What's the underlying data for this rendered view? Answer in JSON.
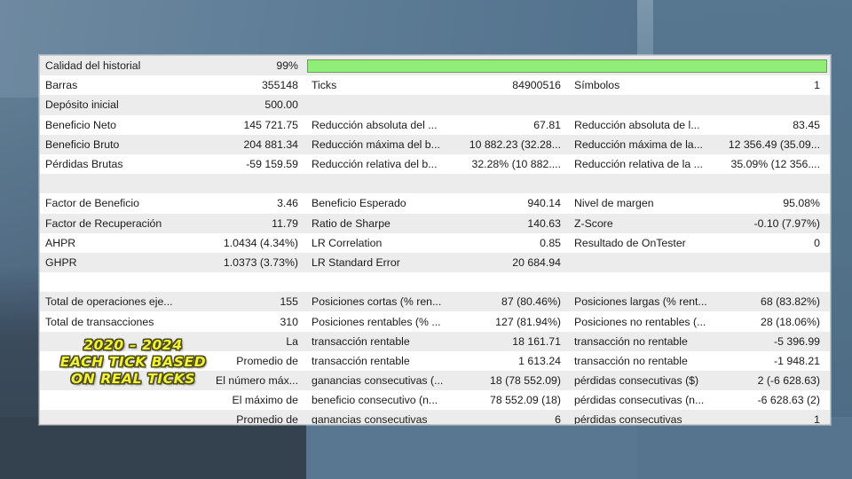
{
  "report": {
    "progress_bar": {
      "label": "",
      "color": "#90ee78",
      "percent": 100
    },
    "rows": [
      {
        "type": "progress",
        "c1_label": "Calidad del historial",
        "c1_value": "99%"
      },
      {
        "type": "data",
        "c1_label": "Barras",
        "c1_value": "355148",
        "c2_label": "Ticks",
        "c2_value": "84900516",
        "c3_label": "Símbolos",
        "c3_value": "1"
      },
      {
        "type": "data",
        "c1_label": "Depósito inicial",
        "c1_value": "500.00",
        "c2_label": "",
        "c2_value": "",
        "c3_label": "",
        "c3_value": ""
      },
      {
        "type": "data",
        "c1_label": "Beneficio Neto",
        "c1_value": "145 721.75",
        "c2_label": "Reducción absoluta del ...",
        "c2_value": "67.81",
        "c3_label": "Reducción absoluta de l...",
        "c3_value": "83.45"
      },
      {
        "type": "data",
        "c1_label": "Beneficio Bruto",
        "c1_value": "204 881.34",
        "c2_label": "Reducción máxima del b...",
        "c2_value": "10 882.23 (32.28...",
        "c3_label": "Reducción máxima de la...",
        "c3_value": "12 356.49 (35.09..."
      },
      {
        "type": "data",
        "c1_label": "Pérdidas Brutas",
        "c1_value": "-59 159.59",
        "c2_label": "Reducción relativa del b...",
        "c2_value": "32.28% (10 882....",
        "c3_label": "Reducción relativa de la ...",
        "c3_value": "35.09% (12 356...."
      },
      {
        "type": "blank",
        "c1_label": "",
        "c1_value": "",
        "c2_label": "",
        "c2_value": "",
        "c3_label": "",
        "c3_value": ""
      },
      {
        "type": "data",
        "c1_label": "Factor de Beneficio",
        "c1_value": "3.46",
        "c2_label": "Beneficio Esperado",
        "c2_value": "940.14",
        "c3_label": "Nivel de margen",
        "c3_value": "95.08%"
      },
      {
        "type": "data",
        "c1_label": "Factor de Recuperación",
        "c1_value": "11.79",
        "c2_label": "Ratio de Sharpe",
        "c2_value": "140.63",
        "c3_label": "Z-Score",
        "c3_value": "-0.10 (7.97%)"
      },
      {
        "type": "data",
        "c1_label": "AHPR",
        "c1_value": "1.0434 (4.34%)",
        "c2_label": "LR Correlation",
        "c2_value": "0.85",
        "c3_label": "Resultado de OnTester",
        "c3_value": "0"
      },
      {
        "type": "data",
        "c1_label": "GHPR",
        "c1_value": "1.0373 (3.73%)",
        "c2_label": "LR Standard Error",
        "c2_value": "20 684.94",
        "c3_label": "",
        "c3_value": ""
      },
      {
        "type": "blank",
        "c1_label": "",
        "c1_value": "",
        "c2_label": "",
        "c2_value": "",
        "c3_label": "",
        "c3_value": ""
      },
      {
        "type": "data",
        "c1_label": "Total de operaciones eje...",
        "c1_value": "155",
        "c2_label": "Posiciones cortas (% ren...",
        "c2_value": "87 (80.46%)",
        "c3_label": "Posiciones largas (% rent...",
        "c3_value": "68 (83.82%)"
      },
      {
        "type": "data",
        "c1_label": "Total de transacciones",
        "c1_value": "310",
        "c2_label": "Posiciones rentables (% ...",
        "c2_value": "127 (81.94%)",
        "c3_label": "Posiciones no rentables (...",
        "c3_value": "28 (18.06%)"
      },
      {
        "type": "data",
        "c1_label": "",
        "c1_value": "La",
        "c2_label": "transacción rentable",
        "c2_value": "18 161.71",
        "c3_label": "transacción no rentable",
        "c3_value": "-5 396.99"
      },
      {
        "type": "data",
        "c1_label": "",
        "c1_value": "Promedio de",
        "c2_label": "transacción rentable",
        "c2_value": "1 613.24",
        "c3_label": "transacción no rentable",
        "c3_value": "-1 948.21"
      },
      {
        "type": "data",
        "c1_label": "",
        "c1_value": "El número máx...",
        "c2_label": "ganancias consecutivas (...",
        "c2_value": "18 (78 552.09)",
        "c3_label": "pérdidas consecutivas ($)",
        "c3_value": "2 (-6 628.63)"
      },
      {
        "type": "data",
        "c1_label": "",
        "c1_value": "El máximo de",
        "c2_label": "beneficio consecutivo (n...",
        "c2_value": "78 552.09 (18)",
        "c3_label": "pérdidas consecutivas (n...",
        "c3_value": "-6 628.63 (2)"
      },
      {
        "type": "data",
        "c1_label": "",
        "c1_value": "Promedio de",
        "c2_label": "ganancias consecutivas",
        "c2_value": "6",
        "c3_label": "pérdidas consecutivas",
        "c3_value": "1"
      }
    ]
  },
  "overlay": {
    "line1": "2020 – 2024",
    "line2": "EACH TICK BASED",
    "line3": "ON REAL TICKS",
    "color": "#f2f23a",
    "outline_color": "#4d4d14"
  }
}
